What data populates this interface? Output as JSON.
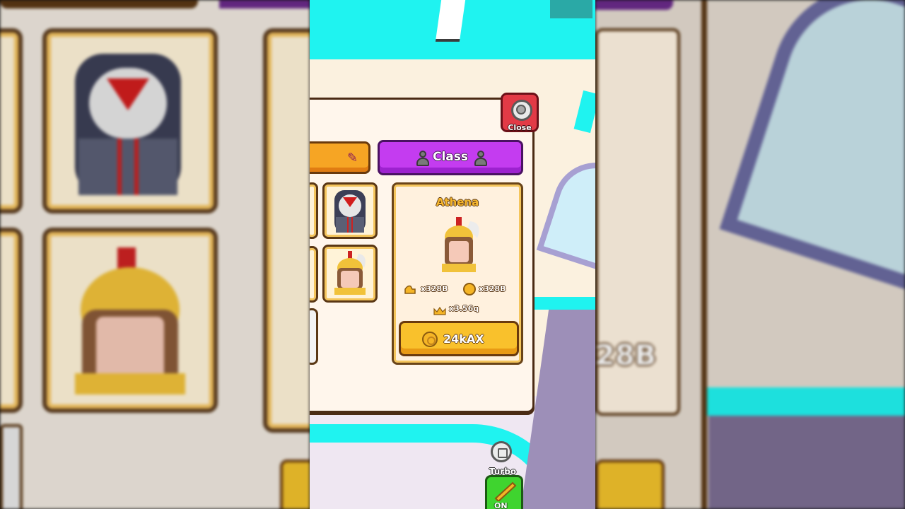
{
  "side_backdrop": {
    "right_stat_text": "28B"
  },
  "close_button": {
    "label": "Close"
  },
  "tabs": [
    {
      "id": "left-tab",
      "label": "",
      "icon": "pencil-ruler-icon"
    },
    {
      "id": "class-tab",
      "label": "Class",
      "icon": "person-icon",
      "active": true
    }
  ],
  "class_grid": [
    {
      "id": "dark-hooded",
      "icon": "masked-hero-icon"
    },
    {
      "id": "athena",
      "icon": "athena-helmet-icon"
    }
  ],
  "selected_class": {
    "name": "Athena",
    "stats": [
      {
        "icon": "strength-arm-icon",
        "value": "x328B"
      },
      {
        "icon": "coin-icon",
        "value": "x328B"
      },
      {
        "icon": "crown-icon",
        "value": "x3.56q"
      }
    ],
    "price_label": "24kAX",
    "price_icon": "coin-icon"
  },
  "turbo": {
    "label": "Turbo",
    "state": "ON"
  },
  "colors": {
    "cyan": "#1ff3f0",
    "class_tab": "#c43cf0",
    "buy_button": "#f9c12c",
    "close_button": "#e23a46",
    "turbo_button": "#3fd42f"
  }
}
